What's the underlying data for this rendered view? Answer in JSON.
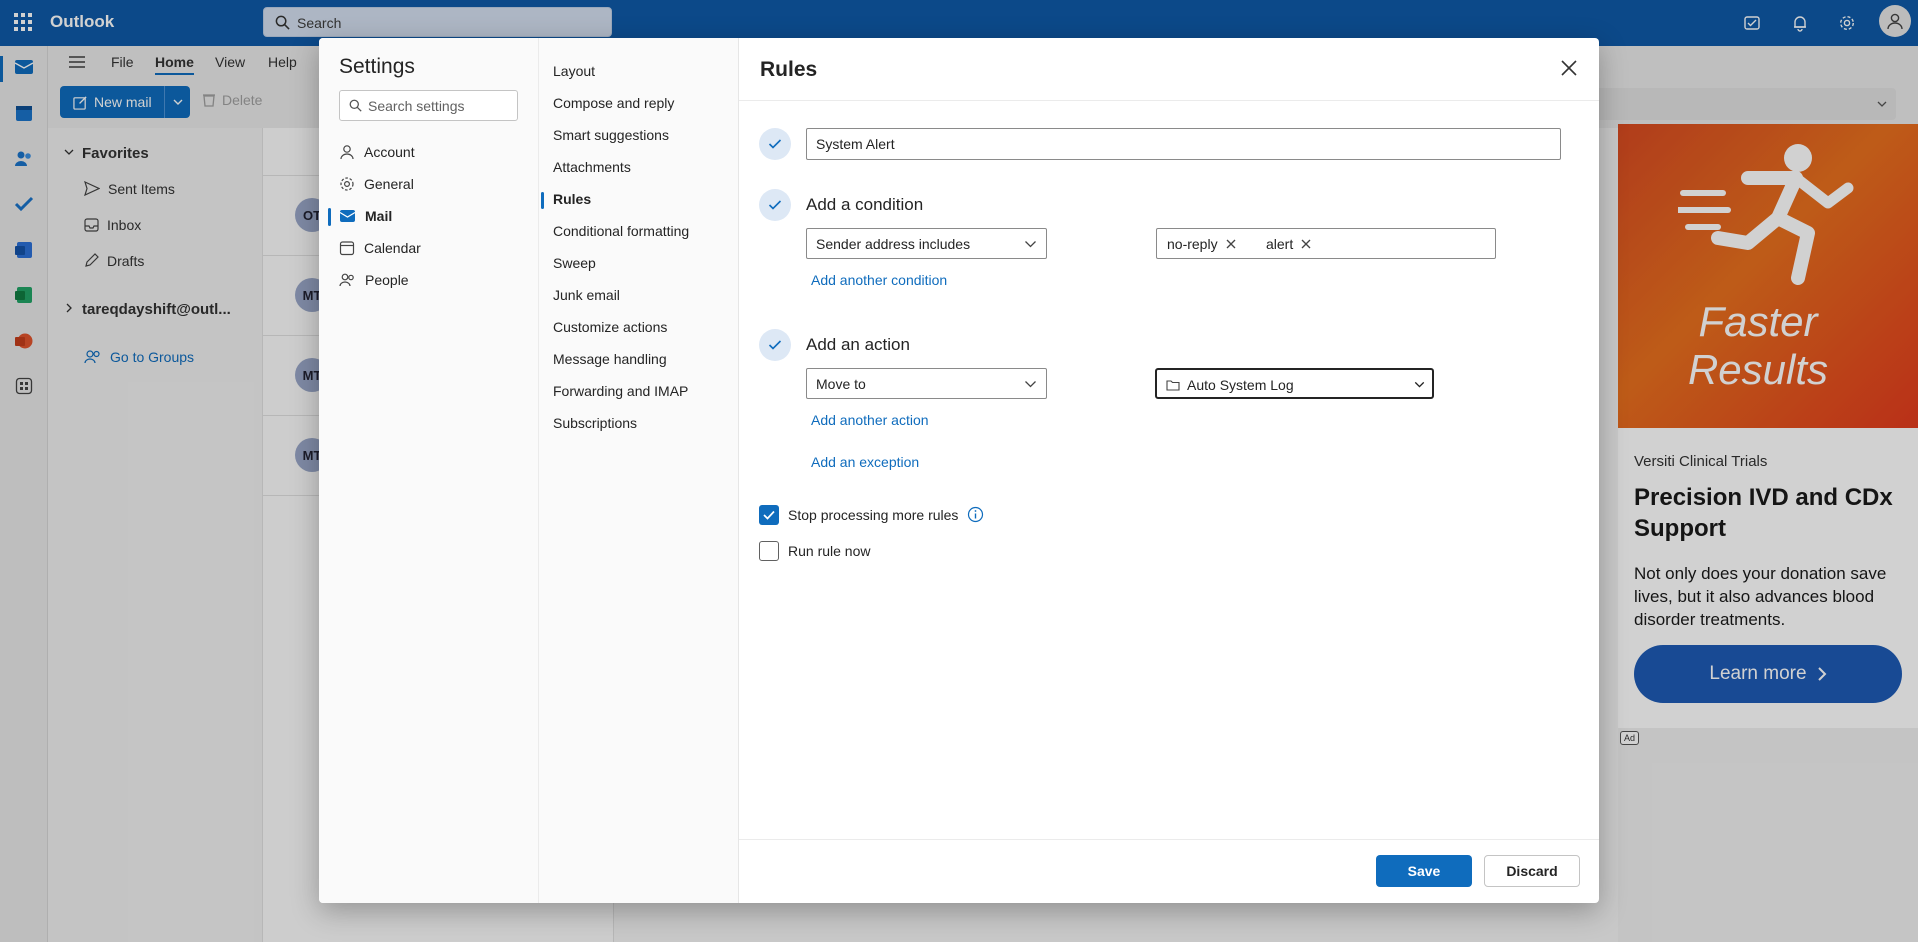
{
  "app": {
    "title": "Outlook",
    "search_placeholder": "Search"
  },
  "ribbon": {
    "tabs": [
      "File",
      "Home",
      "View",
      "Help"
    ],
    "new_mail": "New mail",
    "delete": "Delete"
  },
  "folders": {
    "favorites": "Favorites",
    "items": [
      "Sent Items",
      "Inbox",
      "Drafts"
    ],
    "account": "tareqdayshift@outl...",
    "go_to_groups": "Go to Groups"
  },
  "message_list": {
    "avatars": [
      "OT",
      "MT",
      "MT",
      "MT"
    ]
  },
  "ad": {
    "headline_line1": "Faster",
    "headline_line2": "Results",
    "brand": "Versiti Clinical Trials",
    "title": "Precision IVD and CDx Support",
    "text": "Not only does your donation save lives, but it also advances blood disorder treatments.",
    "cta": "Learn more",
    "badge": "Ad"
  },
  "settings": {
    "title": "Settings",
    "search_placeholder": "Search settings",
    "categories": [
      "Account",
      "General",
      "Mail",
      "Calendar",
      "People"
    ],
    "active_category": "Mail",
    "mail_subpages": [
      "Layout",
      "Compose and reply",
      "Smart suggestions",
      "Attachments",
      "Rules",
      "Conditional formatting",
      "Sweep",
      "Junk email",
      "Customize actions",
      "Message handling",
      "Forwarding and IMAP",
      "Subscriptions"
    ],
    "active_subpage": "Rules"
  },
  "rules": {
    "title": "Rules",
    "rule_name": "System Alert",
    "condition_label": "Add a condition",
    "condition_type": "Sender address includes",
    "condition_values": [
      "no-reply",
      "alert"
    ],
    "add_condition": "Add another condition",
    "action_label": "Add an action",
    "action_type": "Move to",
    "action_folder": "Auto System Log",
    "add_action": "Add another action",
    "add_exception": "Add an exception",
    "stop_processing": {
      "label": "Stop processing more rules",
      "checked": true
    },
    "run_now": {
      "label": "Run rule now",
      "checked": false
    },
    "save": "Save",
    "discard": "Discard"
  }
}
